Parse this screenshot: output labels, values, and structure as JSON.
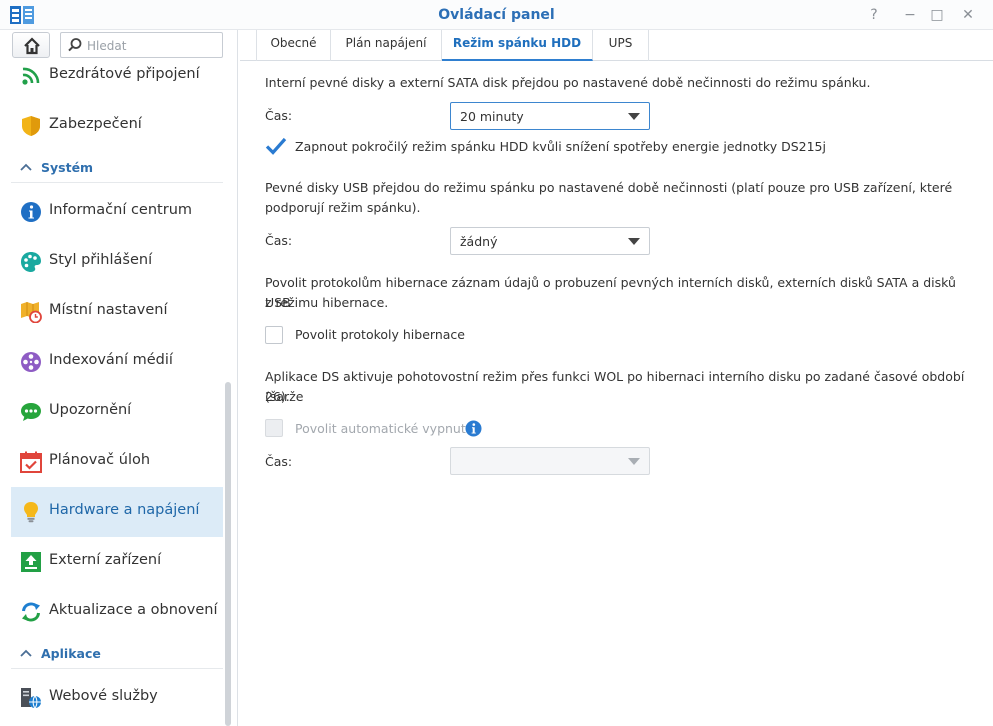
{
  "window": {
    "title": "Ovládací panel",
    "controls": {
      "help": "?",
      "minimize": "−",
      "maximize": "□",
      "close": "✕"
    }
  },
  "search": {
    "placeholder": "Hledat",
    "value": ""
  },
  "sidebar": {
    "items_top": [
      {
        "label": "Bezdrátové připojení",
        "icon": "wifi-icon"
      },
      {
        "label": "Zabezpečení",
        "icon": "shield-icon"
      }
    ],
    "sections": [
      {
        "label": "Systém",
        "items": [
          {
            "label": "Informační centrum",
            "icon": "info-icon"
          },
          {
            "label": "Styl přihlášení",
            "icon": "palette-icon"
          },
          {
            "label": "Místní nastavení",
            "icon": "map-clock-icon"
          },
          {
            "label": "Indexování médií",
            "icon": "film-reel-icon"
          },
          {
            "label": "Upozornění",
            "icon": "chat-bubble-icon"
          },
          {
            "label": "Plánovač úloh",
            "icon": "calendar-check-icon"
          },
          {
            "label": "Hardware a napájení",
            "icon": "lightbulb-icon",
            "active": true
          },
          {
            "label": "Externí zařízení",
            "icon": "upload-arrow-icon"
          },
          {
            "label": "Aktualizace a obnovení",
            "icon": "refresh-icon"
          }
        ]
      },
      {
        "label": "Aplikace",
        "items": [
          {
            "label": "Webové služby",
            "icon": "web-services-icon"
          }
        ]
      }
    ]
  },
  "tabs": [
    {
      "label": "Obecné"
    },
    {
      "label": "Plán napájení"
    },
    {
      "label": "Režim spánku HDD",
      "active": true
    },
    {
      "label": "UPS"
    }
  ],
  "content": {
    "internal": {
      "text": "Interní pevné disky a externí SATA disk přejdou po nastavené době nečinnosti do režimu spánku.",
      "time_label": "Čas:",
      "time_value": "20 minuty",
      "advanced_checkbox": {
        "label": "Zapnout pokročilý režim spánku HDD kvůli snížení spotřeby energie jednotky DS215j",
        "checked": true
      }
    },
    "usb": {
      "text_line1": "Pevné disky USB přejdou do režimu spánku po nastavené době nečinnosti (platí pouze pro USB zařízení, které",
      "text_line2": "podporují režim spánku).",
      "time_label": "Čas:",
      "time_value": "žádný"
    },
    "hibernation": {
      "text_line1": "Povolit protokolům hibernace záznam údajů o probuzení pevných interních disků, externích disků SATA a disků USB",
      "text_line2": "z režimu hibernace.",
      "checkbox": {
        "label": "Povolit protokoly hibernace",
        "checked": false
      }
    },
    "wol": {
      "text_line1": "Aplikace DS aktivuje pohotovostní režim přes funkci WOL po hibernaci interního disku po zadané časové období (šarže",
      "text_line2": "26).",
      "checkbox": {
        "label": "Povolit automatické vypnutí",
        "checked": false,
        "disabled": true
      },
      "time_label": "Čas:",
      "time_value": ""
    }
  },
  "colors": {
    "accent": "#2c6fb6",
    "active_bg": "#dcebf7",
    "check": "#2a7bd1"
  }
}
